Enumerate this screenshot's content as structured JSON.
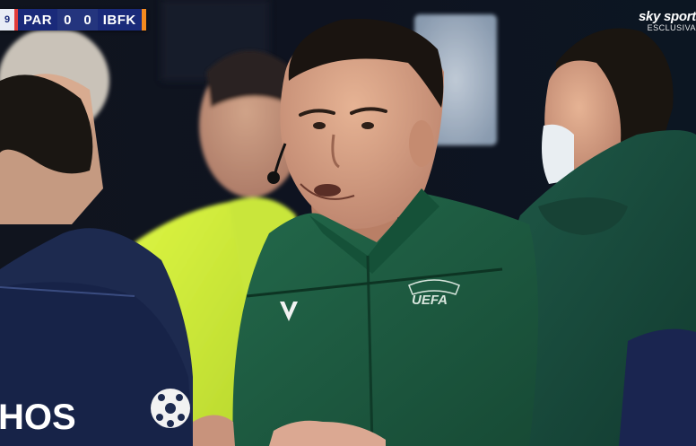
{
  "scorebug": {
    "clock": "9",
    "home_team": "PAR",
    "home_score": "0",
    "away_score": "0",
    "away_team": "IBFK"
  },
  "broadcaster": {
    "name": "sky sport",
    "sub": "ESCLUSIVA"
  },
  "referee": {
    "badge_text": "UEFA"
  },
  "player": {
    "shirt_text": "HOS"
  },
  "colors": {
    "scorebug_blue": "#1a2a7a",
    "home_accent": "#e23b3b",
    "away_accent": "#f58a1f",
    "referee_jacket": "#1d5c41",
    "assistant_vest": "#d4ee3a",
    "player_kit": "#172348"
  }
}
